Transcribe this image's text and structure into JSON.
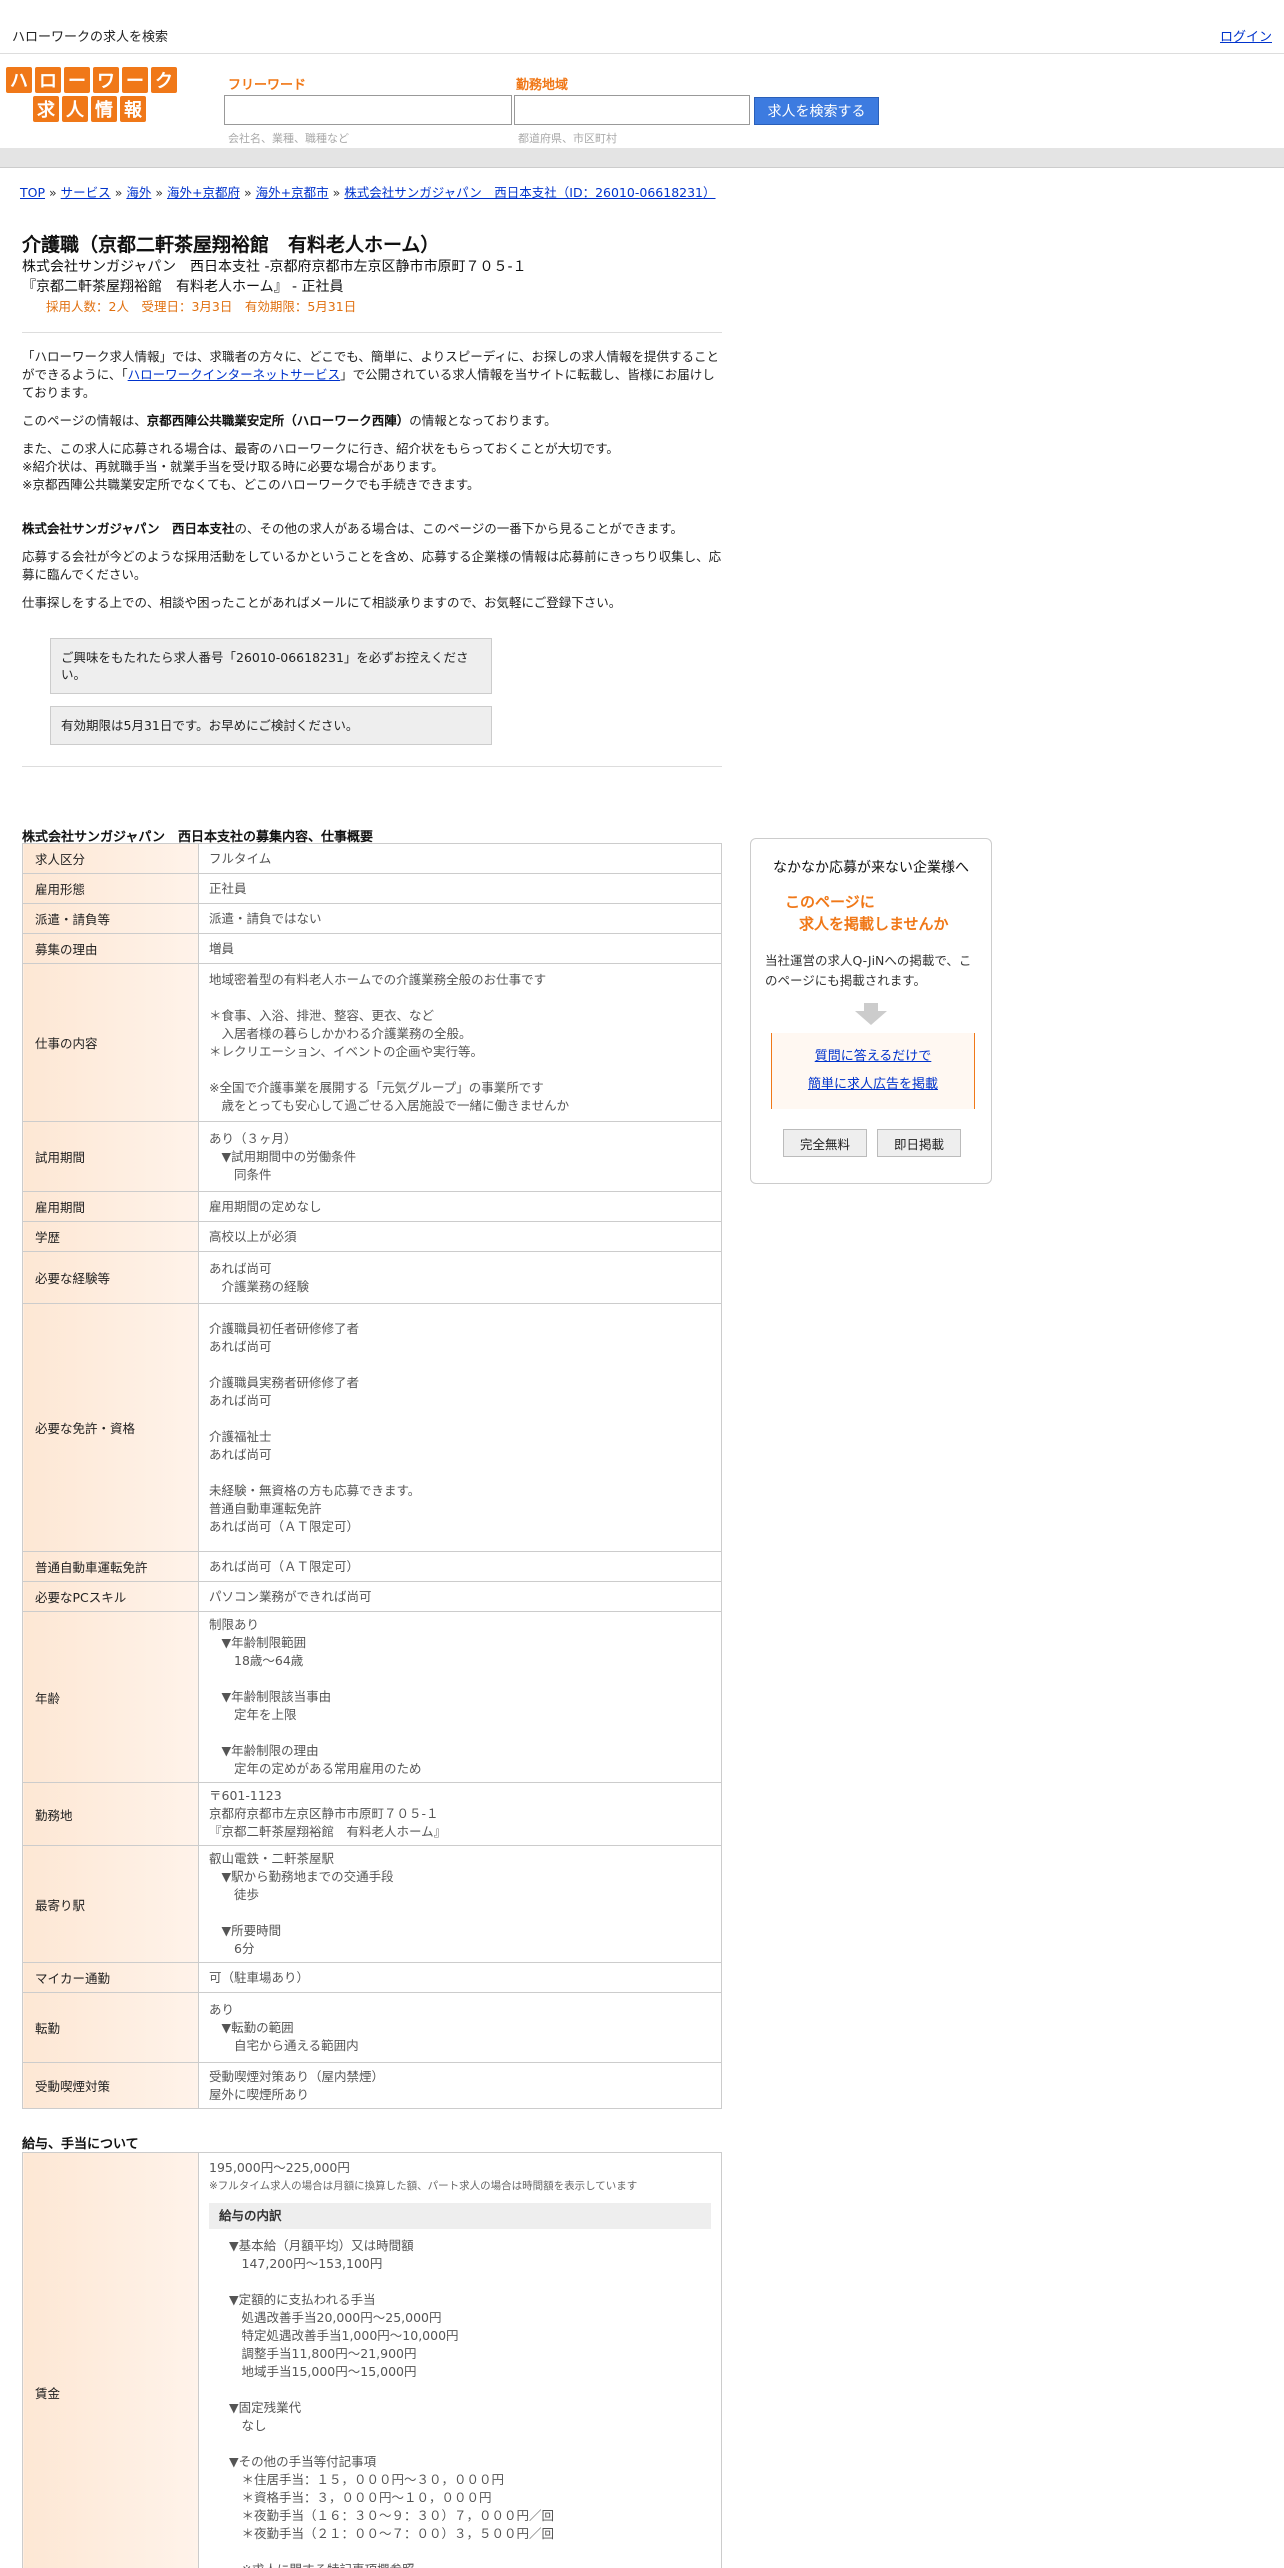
{
  "topbar": {
    "site_label": "ハローワークの求人を検索",
    "login": "ログイン"
  },
  "logo": {
    "row1": [
      "ハ",
      "ロ",
      "ー",
      "ワ",
      "ー",
      "ク"
    ],
    "row2": [
      "求",
      "人",
      "情",
      "報"
    ],
    "color": "#f07818"
  },
  "search": {
    "keyword_label": "フリーワード",
    "keyword_hint": "会社名、業種、職種など",
    "area_label": "勤務地域",
    "area_hint": "都道府県、市区町村",
    "button": "求人を検索する"
  },
  "breadcrumb": [
    "TOP",
    "サービス",
    "海外",
    "海外+京都府",
    "海外+京都市",
    "株式会社サンガジャパン　西日本支社（ID：26010-06618231）"
  ],
  "job": {
    "title": "介護職（京都二軒茶屋翔裕館　有料老人ホーム）",
    "company_line": "株式会社サンガジャパン　西日本支社 -京都府京都市左京区静市市原町７０５-１",
    "workplace_line": "『京都二軒茶屋翔裕館　有料老人ホーム』 - 正社員",
    "meta": "採用人数：2人　受理日：3月3日　有効期限：5月31日"
  },
  "intro": {
    "p1_a": "「ハローワーク求人情報」では、求職者の方々に、どこでも、簡単に、よりスピーディに、お探しの求人情報を提供することができるように、「",
    "p1_link": "ハローワークインターネットサービス",
    "p1_b": "」で公開されている求人情報を当サイトに転載し、皆様にお届けしております。",
    "p2_a": "このページの情報は、",
    "p2_bold": "京都西陣公共職業安定所（ハローワーク西陣）",
    "p2_b": "の情報となっております。",
    "p3_1": "また、この求人に応募される場合は、最寄のハローワークに行き、紹介状をもらっておくことが大切です。",
    "p3_2": "※紹介状は、再就職手当・就業手当を受け取る時に必要な場合があります。",
    "p3_3": "※京都西陣公共職業安定所でなくても、どこのハローワークでも手続きできます。",
    "p4_bold": "株式会社サンガジャパン　西日本支社",
    "p4_rest": "の、その他の求人がある場合は、このページの一番下から見ることができます。",
    "p5": "応募する会社が今どのような採用活動をしているかということを含め、応募する企業様の情報は応募前にきっちり収集し、応募に臨んでください。",
    "p6": "仕事探しをする上での、相談や困ったことがあればメールにて相談承りますので、お気軽にご登録下さい。"
  },
  "notices": {
    "n1": "ご興味をもたれたら求人番号「26010-06618231」を必ずお控えください。",
    "n2": "有効期限は5月31日です。お早めにご検討ください。"
  },
  "summary_title": "株式会社サンガジャパン　西日本支社の募集内容、仕事概要",
  "rows": [
    {
      "label": "求人区分",
      "value": "フルタイム"
    },
    {
      "label": "雇用形態",
      "value": "正社員"
    },
    {
      "label": "派遣・請負等",
      "value": "派遣・請負ではない"
    },
    {
      "label": "募集の理由",
      "value": "増員"
    },
    {
      "label": "仕事の内容",
      "value": "地域密着型の有料老人ホームでの介護業務全般のお仕事です\n\n＊食事、入浴、排泄、整容、更衣、など\n　入居者様の暮らしかかわる介護業務の全般。\n＊レクリエーション、イベントの企画や実行等。\n\n※全国で介護事業を展開する「元気グループ」の事業所です\n　歳をとっても安心して過ごせる入居施設で一緒に働きませんか"
    },
    {
      "label": "試用期間",
      "value": "あり（３ヶ月）\n　▼試用期間中の労働条件\n　　同条件"
    },
    {
      "label": "雇用期間",
      "value": "雇用期間の定めなし"
    },
    {
      "label": "学歴",
      "value": "高校以上が必須"
    },
    {
      "label": "必要な経験等",
      "value": "あれば尚可\n　介護業務の経験"
    },
    {
      "label": "必要な免許・資格",
      "value": "介護職員初任者研修修了者\nあれば尚可\n\n介護職員実務者研修修了者\nあれば尚可\n\n介護福祉士\nあれば尚可\n\n未経験・無資格の方も応募できます。\n普通自動車運転免許\nあれば尚可（ＡＴ限定可）"
    },
    {
      "label": "普通自動車運転免許",
      "value": "あれば尚可（ＡＴ限定可）"
    },
    {
      "label": "必要なPCスキル",
      "value": "パソコン業務ができれば尚可"
    },
    {
      "label": "年齢",
      "value": "制限あり\n　▼年齢制限範囲\n　　18歳〜64歳\n\n　▼年齢制限該当事由\n　　定年を上限\n\n　▼年齢制限の理由\n　　定年の定めがある常用雇用のため"
    },
    {
      "label": "勤務地",
      "value": "〒601-1123\n京都府京都市左京区静市市原町７０５-１\n『京都二軒茶屋翔裕館　有料老人ホーム』"
    },
    {
      "label": "最寄り駅",
      "value": "叡山電鉄・二軒茶屋駅\n　▼駅から勤務地までの交通手段\n　　徒歩\n\n　▼所要時間\n　　6分"
    },
    {
      "label": "マイカー通勤",
      "value": "可（駐車場あり）"
    },
    {
      "label": "転勤",
      "value": "あり\n　▼転勤の範囲\n　　自宅から通える範囲内"
    },
    {
      "label": "受動喫煙対策",
      "value": "受動喫煙対策あり（屋内禁煙）\n屋外に喫煙所あり"
    }
  ],
  "wage_title": "給与、手当について",
  "wage": {
    "label": "賃金",
    "range": "195,000円〜225,000円",
    "note": "※フルタイム求人の場合は月額に換算した額、パート求人の場合は時間額を表示しています",
    "breakdown_title": "給与の内訳",
    "breakdown": "▼基本給（月額平均）又は時間額\n　147,200円〜153,100円\n\n▼定額的に支払われる手当\n　処遇改善手当20,000円〜25,000円\n　特定処遇改善手当1,000円〜10,000円\n　調整手当11,800円〜21,900円\n　地域手当15,000円〜15,000円\n\n▼固定残業代\n　なし\n\n▼その他の手当等付記事項\n　＊住居手当：１５，０００円〜３０，０００円\n　＊資格手当：３，０００円〜１０，０００円\n　＊夜勤手当（１６：３０〜９：３０）７，０００円／回\n　＊夜勤手当（２１：００〜７：００）３，５００円／回\n\n　※求人に関する特記事項欄参照"
  },
  "ad": {
    "title": "なかなか応募が来ない企業様へ",
    "catch1": "このページに",
    "catch2": "求人を掲載しませんか",
    "desc": "当社運営の求人Q-JiNへの掲載で、このページにも掲載されます。",
    "link1": "質問に答えるだけで",
    "link2": "簡単に求人広告を掲載",
    "btn1": "完全無料",
    "btn2": "即日掲載"
  }
}
